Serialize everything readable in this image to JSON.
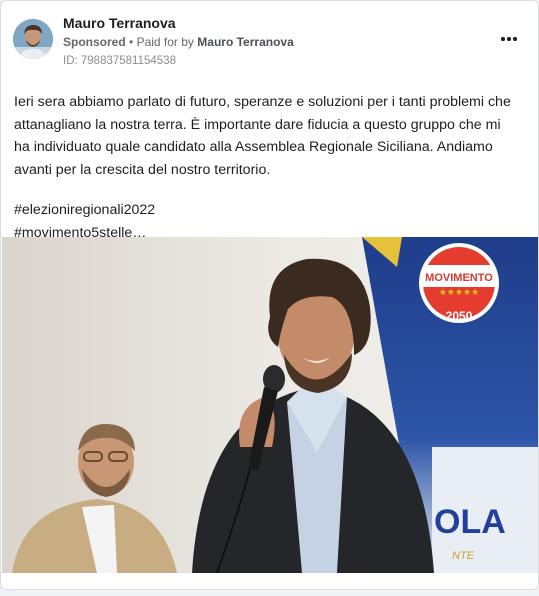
{
  "post": {
    "author": "Mauro Terranova",
    "sponsored_label": "Sponsored",
    "paid_prefix": "Paid for by",
    "paid_by": "Mauro Terranova",
    "ad_id": "ID: 798837581154538",
    "paragraph": "Ieri sera abbiamo parlato di futuro, speranze e soluzioni per i tanti problemi che attanagliano la nostra terra. È importante dare fiducia a questo gruppo che mi ha individuato quale candidato alla Assemblea Regionale Siciliana. Andiamo avanti per la crescita del nostro territorio.",
    "hashtag_1": "#elezioniregionali2022",
    "hashtag_2": "#movimento5stelle…"
  },
  "banner": {
    "logo_word": "MOVIMENTO",
    "logo_number": "2050",
    "bottom_text": "OLA",
    "bottom_small": "NTE"
  },
  "icons": {
    "avatar": "profile-avatar",
    "more": "more-options-icon"
  }
}
